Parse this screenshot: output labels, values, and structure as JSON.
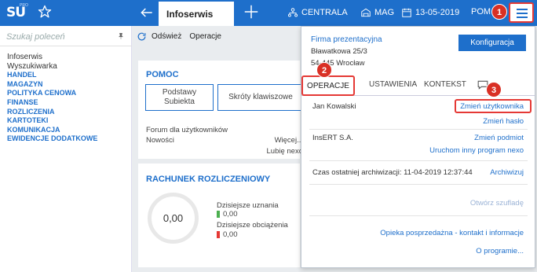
{
  "topbar": {
    "logo_text": "SU",
    "logo_super": "PRO",
    "active_tab": "Infoserwis",
    "centrala": "CENTRALA",
    "mag": "MAG",
    "date": "13-05-2019",
    "user": "POM"
  },
  "sidebar": {
    "search_placeholder": "Szukaj poleceń",
    "items": [
      {
        "label": "Infoserwis",
        "type": "plain"
      },
      {
        "label": "Wyszukiwarka",
        "type": "plain"
      },
      {
        "label": "HANDEL",
        "type": "cat"
      },
      {
        "label": "MAGAZYN",
        "type": "cat"
      },
      {
        "label": "POLITYKA CENOWA",
        "type": "cat"
      },
      {
        "label": "FINANSE",
        "type": "cat"
      },
      {
        "label": "ROZLICZENIA",
        "type": "cat"
      },
      {
        "label": "KARTOTEKI",
        "type": "cat"
      },
      {
        "label": "KOMUNIKACJA",
        "type": "cat"
      },
      {
        "label": "EWIDENCJE DODATKOWE",
        "type": "cat"
      }
    ]
  },
  "toolbar": {
    "refresh": "Odśwież",
    "operations": "Operacje"
  },
  "help_card": {
    "title": "POMOC",
    "btn_basics": "Podstawy Subiekta",
    "btn_shortcuts": "Skróty klawiszowe",
    "forum": "Forum dla użytkowników",
    "news": "Nowości",
    "more": "Więcej...",
    "likes": "Lubię nexo"
  },
  "account_card": {
    "title": "RACHUNEK ROZLICZENIOWY",
    "amount": "0,00",
    "credits_label": "Dzisiejsze uznania",
    "credits_value": "0,00",
    "debits_label": "Dzisiejsze obciążenia",
    "debits_value": "0,00"
  },
  "panel": {
    "company_name": "Firma prezentacyjna",
    "street": "Bławatkowa 25/3",
    "city": "54-445 Wrocław",
    "config_button": "Konfiguracja",
    "tabs": [
      "OPERACJE",
      "USTAWIENIA",
      "KONTEKST"
    ],
    "user_name": "Jan Kowalski",
    "change_user": "Zmień użytkownika",
    "change_password": "Zmień hasło",
    "entity_name": "InsERT S.A.",
    "change_entity": "Zmień podmiot",
    "run_other": "Uruchom inny program nexo",
    "archive_label": "Czas ostatniej archiwizacji: 11-04-2019 12:37:44",
    "archive_link": "Archiwizuj",
    "open_drawers": "Otwórz szufladę",
    "support": "Opieka posprzedażna - kontakt i informacje",
    "about": "O programie..."
  },
  "badges": [
    "1",
    "2",
    "3"
  ],
  "colors": {
    "primary": "#1e6fcb",
    "highlight": "#e53935",
    "credit": "#4caf50",
    "debit": "#e53935"
  }
}
